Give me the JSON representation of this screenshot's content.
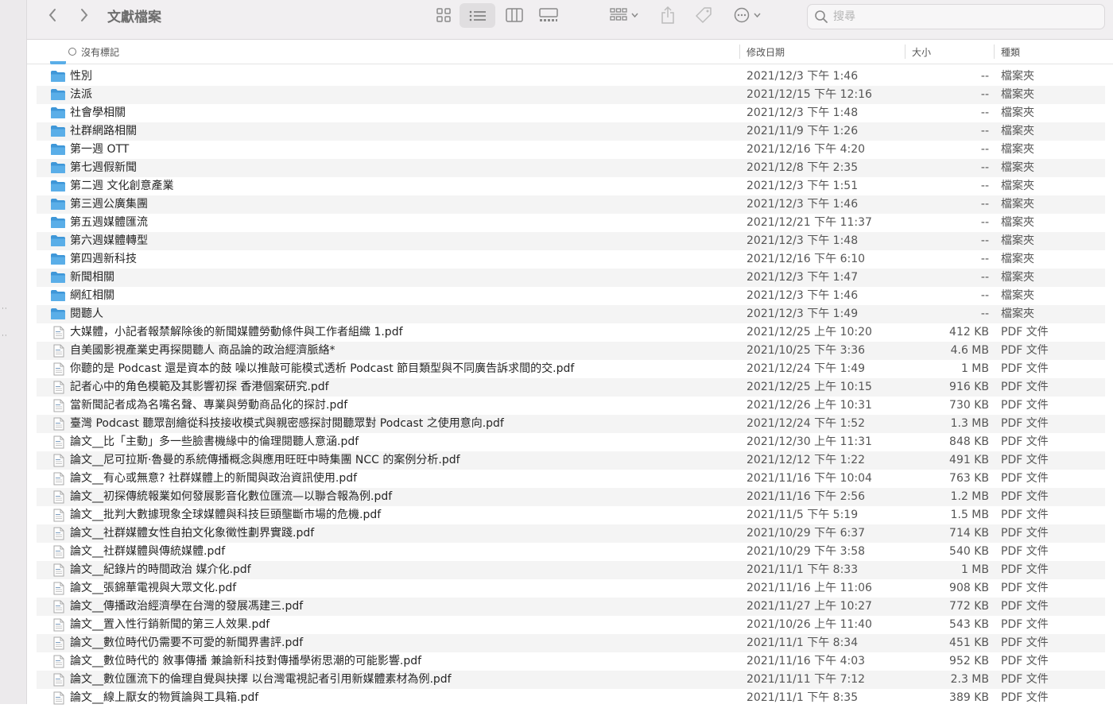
{
  "window": {
    "title": "文獻檔案"
  },
  "search": {
    "placeholder": "搜尋"
  },
  "header": {
    "name": "沒有標記",
    "date": "修改日期",
    "size": "大小",
    "kind": "種類"
  },
  "colors": {
    "folder": "#5aaee8",
    "folder_tab": "#3f97d8",
    "row_alt": "#f4f4f4",
    "toolbar_bg": "#f1eff1"
  },
  "rows": [
    {
      "type": "folder",
      "name": "性別",
      "date": "2021/12/3 下午 1:46",
      "size": "--",
      "kind": "檔案夾"
    },
    {
      "type": "folder",
      "name": "法派",
      "date": "2021/12/15 下午 12:16",
      "size": "--",
      "kind": "檔案夾"
    },
    {
      "type": "folder",
      "name": "社會學相關",
      "date": "2021/12/3 下午 1:48",
      "size": "--",
      "kind": "檔案夾"
    },
    {
      "type": "folder",
      "name": "社群網路相關",
      "date": "2021/11/9 下午 1:26",
      "size": "--",
      "kind": "檔案夾"
    },
    {
      "type": "folder",
      "name": "第一週 OTT",
      "date": "2021/12/16 下午 4:20",
      "size": "--",
      "kind": "檔案夾"
    },
    {
      "type": "folder",
      "name": "第七週假新聞",
      "date": "2021/12/8 下午 2:35",
      "size": "--",
      "kind": "檔案夾"
    },
    {
      "type": "folder",
      "name": "第二週 文化創意產業",
      "date": "2021/12/3 下午 1:51",
      "size": "--",
      "kind": "檔案夾"
    },
    {
      "type": "folder",
      "name": "第三週公廣集團",
      "date": "2021/12/3 下午 1:46",
      "size": "--",
      "kind": "檔案夾"
    },
    {
      "type": "folder",
      "name": "第五週媒體匯流",
      "date": "2021/12/21 下午 11:37",
      "size": "--",
      "kind": "檔案夾"
    },
    {
      "type": "folder",
      "name": "第六週媒體轉型",
      "date": "2021/12/3 下午 1:48",
      "size": "--",
      "kind": "檔案夾"
    },
    {
      "type": "folder",
      "name": "第四週新科技",
      "date": "2021/12/16 下午 6:10",
      "size": "--",
      "kind": "檔案夾"
    },
    {
      "type": "folder",
      "name": "新聞相關",
      "date": "2021/12/3 下午 1:47",
      "size": "--",
      "kind": "檔案夾"
    },
    {
      "type": "folder",
      "name": "網紅相關",
      "date": "2021/12/3 下午 1:46",
      "size": "--",
      "kind": "檔案夾"
    },
    {
      "type": "folder",
      "name": "閱聽人",
      "date": "2021/12/3 下午 1:49",
      "size": "--",
      "kind": "檔案夾"
    },
    {
      "type": "pdf",
      "name": "大媒體，小記者報禁解除後的新聞媒體勞動條件與工作者組織 1.pdf",
      "date": "2021/12/25 上午 10:20",
      "size": "412 KB",
      "kind": "PDF 文件"
    },
    {
      "type": "pdf",
      "name": "自美國影視產業史再探閱聽人 商品論的政治經濟脈絡*",
      "date": "2021/10/25 下午 3:36",
      "size": "4.6 MB",
      "kind": "PDF 文件"
    },
    {
      "type": "pdf",
      "name": "你聽的是 Podcast 還是資本的鼓 噪以推敲可能模式透析 Podcast 節目類型與不同廣告訴求間的交.pdf",
      "date": "2021/12/24 下午 1:49",
      "size": "1 MB",
      "kind": "PDF 文件"
    },
    {
      "type": "pdf",
      "name": "記者心中的角色模範及其影響初探 香港個案研究.pdf",
      "date": "2021/12/25 上午 10:15",
      "size": "916 KB",
      "kind": "PDF 文件"
    },
    {
      "type": "pdf",
      "name": "當新聞記者成為名嘴名聲、專業與勞動商品化的探討.pdf",
      "date": "2021/12/26 上午 10:31",
      "size": "730 KB",
      "kind": "PDF 文件"
    },
    {
      "type": "pdf",
      "name": "臺灣 Podcast 聽眾剖繪從科技接收模式與親密感探討閱聽眾對 Podcast 之使用意向.pdf",
      "date": "2021/12/24 下午 1:52",
      "size": "1.3 MB",
      "kind": "PDF 文件"
    },
    {
      "type": "pdf",
      "name": "論文__比「主動」多一些臉書機緣中的倫理閱聽人意涵.pdf",
      "date": "2021/12/30 上午 11:31",
      "size": "848 KB",
      "kind": "PDF 文件"
    },
    {
      "type": "pdf",
      "name": "論文__尼可拉斯·魯曼的系統傳播概念與應用旺旺中時集團  NCC 的案例分析.pdf",
      "date": "2021/12/12 下午 1:22",
      "size": "491 KB",
      "kind": "PDF 文件"
    },
    {
      "type": "pdf",
      "name": "論文__有心或無意? 社群媒體上的新聞與政治資訊使用.pdf",
      "date": "2021/11/16 下午 10:04",
      "size": "763 KB",
      "kind": "PDF 文件"
    },
    {
      "type": "pdf",
      "name": "論文__初探傳統報業如何發展影音化數位匯流—以聯合報為例.pdf",
      "date": "2021/11/16 下午 2:56",
      "size": "1.2 MB",
      "kind": "PDF 文件"
    },
    {
      "type": "pdf",
      "name": "論文__批判大數據現象全球媒體與科技巨頭壟斷市場的危機.pdf",
      "date": "2021/11/5 下午 5:19",
      "size": "1.5 MB",
      "kind": "PDF 文件"
    },
    {
      "type": "pdf",
      "name": "論文__社群媒體女性自拍文化象徵性劃界實踐.pdf",
      "date": "2021/10/29 下午 6:37",
      "size": "714 KB",
      "kind": "PDF 文件"
    },
    {
      "type": "pdf",
      "name": "論文__社群媒體與傳統媒體.pdf",
      "date": "2021/10/29 下午 3:58",
      "size": "540 KB",
      "kind": "PDF 文件"
    },
    {
      "type": "pdf",
      "name": "論文__紀錄片的時間政治 媒介化.pdf",
      "date": "2021/11/1 下午 8:33",
      "size": "1 MB",
      "kind": "PDF 文件"
    },
    {
      "type": "pdf",
      "name": "論文__張錦華電視與大眾文化.pdf",
      "date": "2021/11/16 上午 11:06",
      "size": "908 KB",
      "kind": "PDF 文件"
    },
    {
      "type": "pdf",
      "name": "論文__傳播政治經濟學在台灣的發展馮建三.pdf",
      "date": "2021/11/27 上午 10:27",
      "size": "772 KB",
      "kind": "PDF 文件"
    },
    {
      "type": "pdf",
      "name": "論文__置入性行銷新聞的第三人效果.pdf",
      "date": "2021/10/26 上午 11:40",
      "size": "543 KB",
      "kind": "PDF 文件"
    },
    {
      "type": "pdf",
      "name": "論文__數位時代仍需要不可愛的新聞界書評.pdf",
      "date": "2021/11/1 下午 8:34",
      "size": "451 KB",
      "kind": "PDF 文件"
    },
    {
      "type": "pdf",
      "name": "論文__數位時代的 敘事傳播 兼論新科技對傳播學術思潮的可能影響.pdf",
      "date": "2021/11/16 下午 4:03",
      "size": "952 KB",
      "kind": "PDF 文件"
    },
    {
      "type": "pdf",
      "name": "論文__數位匯流下的倫理自覺與抉擇 以台灣電視記者引用新媒體素材為例.pdf",
      "date": "2021/11/11 下午 7:12",
      "size": "2.3 MB",
      "kind": "PDF 文件"
    },
    {
      "type": "pdf",
      "name": "論文__線上厭女的物質論與工具箱.pdf",
      "date": "2021/11/1 下午 8:35",
      "size": "389 KB",
      "kind": "PDF 文件"
    }
  ]
}
